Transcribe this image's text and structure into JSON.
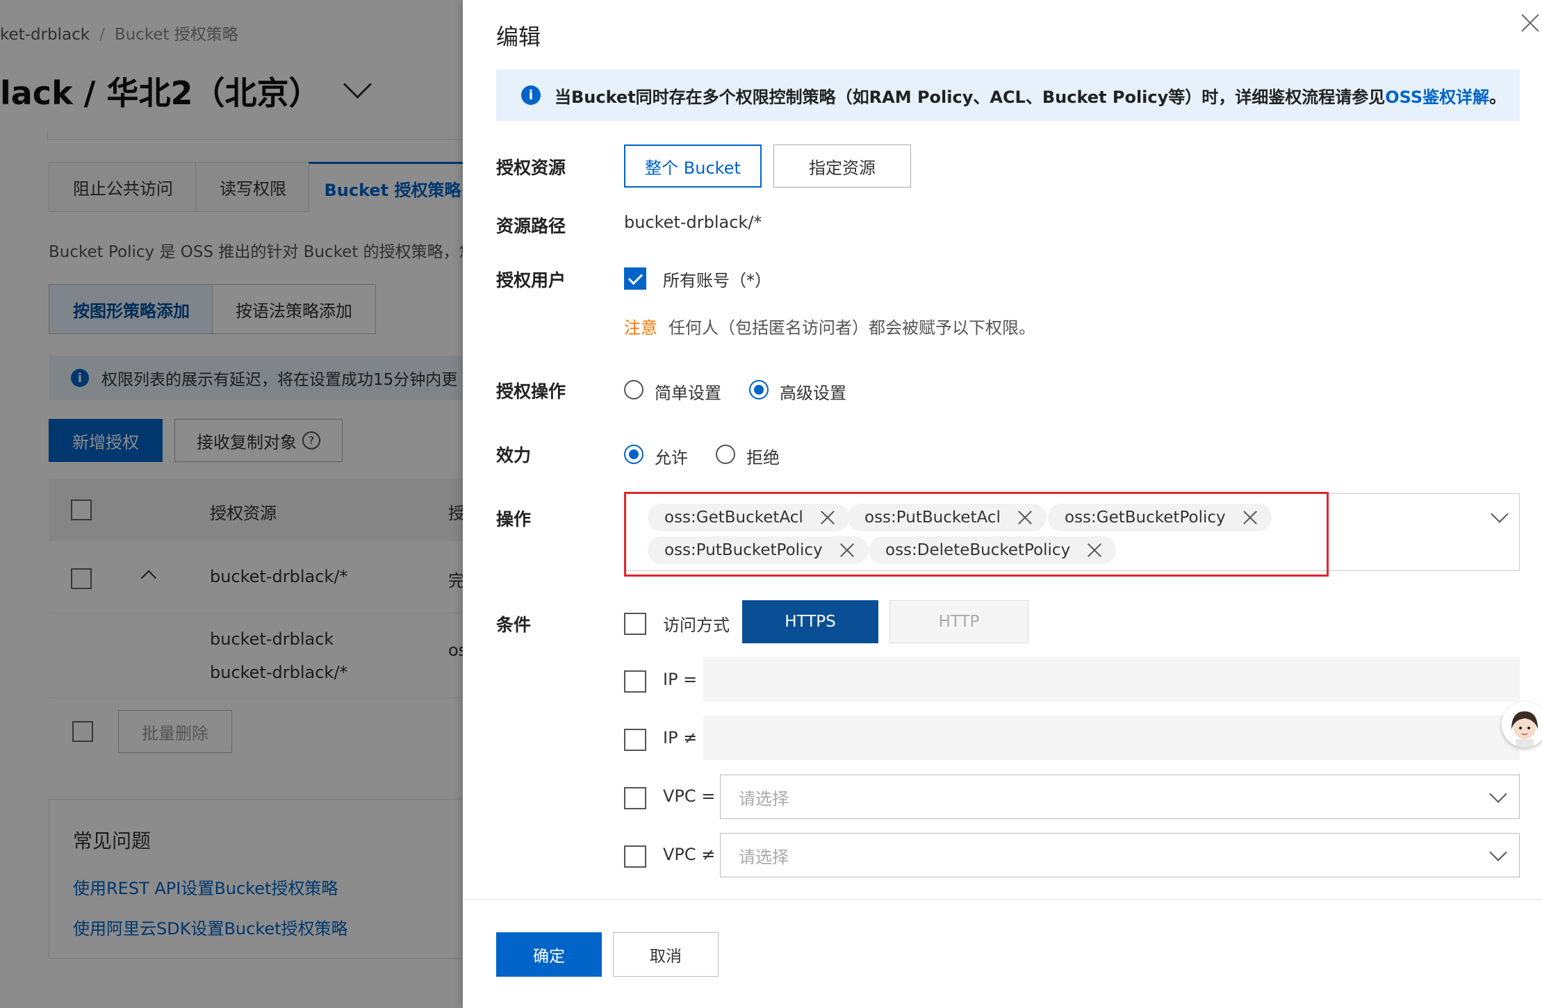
{
  "background": {
    "breadcrumb": {
      "item1": "ket-drblack",
      "separator": "/",
      "item2": "Bucket 授权策略"
    },
    "page_title": "lack / 华北2（北京）",
    "tabs": [
      "阻止公共访问",
      "读写权限",
      "Bucket 授权策略"
    ],
    "description": "Bucket Policy 是 OSS 推出的针对 Bucket 的授权策略，您",
    "modes": [
      "按图形策略添加",
      "按语法策略添加"
    ],
    "notice": "权限列表的展示有延迟，将在设置成功15分钟内更",
    "buttons": {
      "add": "新增授权",
      "receive": "接收复制对象",
      "receive_help": "?"
    },
    "table": {
      "headers": [
        "授权资源",
        "授"
      ],
      "row1": {
        "resource": "bucket-drblack/*",
        "col2": "完"
      },
      "row2": {
        "resource_a": "bucket-drblack",
        "resource_b": "bucket-drblack/*",
        "col2": "os"
      }
    },
    "batch_delete": "批量删除",
    "faq": {
      "title": "常见问题",
      "links": [
        "使用REST API设置Bucket授权策略",
        "使用阿里云SDK设置Bucket授权策略"
      ]
    }
  },
  "drawer": {
    "title": "编辑",
    "notice_text": "当Bucket同时存在多个权限控制策略（如RAM Policy、ACL、Bucket Policy等）时，详细鉴权流程请参见",
    "notice_link": "OSS鉴权详解",
    "notice_end": "。",
    "labels": {
      "resource": "授权资源",
      "path": "资源路径",
      "user": "授权用户",
      "operation_mode": "授权操作",
      "effect": "效力",
      "actions": "操作",
      "conditions": "条件"
    },
    "resource_options": [
      "整个 Bucket",
      "指定资源"
    ],
    "resource_path": "bucket-drblack/*",
    "all_accounts": "所有账号（*）",
    "warning_label": "注意",
    "warning_text": "任何人（包括匿名访问者）都会被赋予以下权限。",
    "operation_options": [
      "简单设置",
      "高级设置"
    ],
    "effect_options": [
      "允许",
      "拒绝"
    ],
    "action_tags": [
      "oss:GetBucketAcl",
      "oss:PutBucketAcl",
      "oss:GetBucketPolicy",
      "oss:PutBucketPolicy",
      "oss:DeleteBucketPolicy"
    ],
    "conditions": {
      "access_method": "访问方式",
      "protocols": [
        "HTTPS",
        "HTTP"
      ],
      "ip_eq": "IP =",
      "ip_neq": "IP ≠",
      "vpc_eq": "VPC =",
      "vpc_neq": "VPC ≠",
      "select_placeholder": "请选择"
    },
    "footer": {
      "confirm": "确定",
      "cancel": "取消"
    }
  },
  "colors": {
    "primary": "#0064c8",
    "highlight": "#e0262a",
    "warning": "#f07800"
  }
}
